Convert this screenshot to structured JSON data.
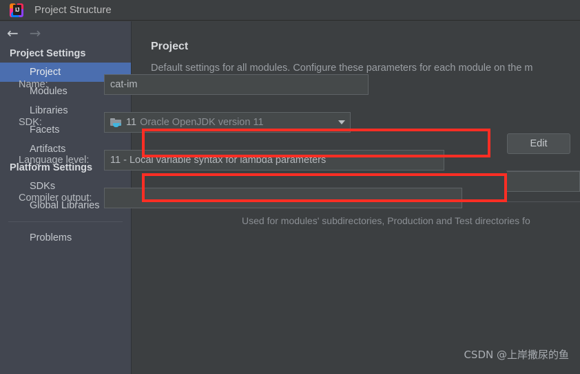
{
  "window": {
    "title": "Project Structure",
    "logo_icon": "intellij-idea-logo",
    "logo_letters": "IJ"
  },
  "colors": {
    "background": "#3c3f41",
    "sidebar_background": "#424650",
    "selection_blue": "#4b6eaf",
    "annotation_red": "#fd2e24",
    "field_background": "#45494a",
    "text_primary": "#b6babf",
    "text_muted": "#8a8e93"
  },
  "nav": {
    "back_icon": "arrow-left-icon",
    "back_glyph": "←",
    "forward_icon": "arrow-right-icon",
    "forward_glyph": "→"
  },
  "sidebar": {
    "groups": [
      {
        "label": "Project Settings",
        "items": [
          {
            "label": "Project",
            "selected": true
          },
          {
            "label": "Modules",
            "selected": false
          },
          {
            "label": "Libraries",
            "selected": false
          },
          {
            "label": "Facets",
            "selected": false
          },
          {
            "label": "Artifacts",
            "selected": false
          }
        ]
      },
      {
        "label": "Platform Settings",
        "items": [
          {
            "label": "SDKs",
            "selected": false
          },
          {
            "label": "Global Libraries",
            "selected": false
          }
        ]
      }
    ],
    "problems_label": "Problems"
  },
  "main": {
    "title": "Project",
    "description": "Default settings for all modules. Configure these parameters for each module on the m",
    "rows": {
      "name": {
        "label": "Name:",
        "value": "cat-im"
      },
      "sdk": {
        "label": "SDK:",
        "icon": "jdk-folder-icon",
        "version": "11",
        "name": "Oracle OpenJDK version 11",
        "dropdown_icon": "chevron-down-icon",
        "edit_button": "Edit"
      },
      "language_level": {
        "label": "Language level:",
        "value": "11 - Local variable syntax for lambda parameters"
      },
      "compiler_output": {
        "label": "Compiler output:",
        "value": "",
        "hint": "Used for modules' subdirectories, Production and Test directories fo"
      }
    }
  },
  "annotations": {
    "sdk_highlight": "red-rectangle",
    "language_level_highlight": "red-rectangle"
  },
  "watermark": {
    "text": "CSDN @上岸撒尿的鱼"
  }
}
